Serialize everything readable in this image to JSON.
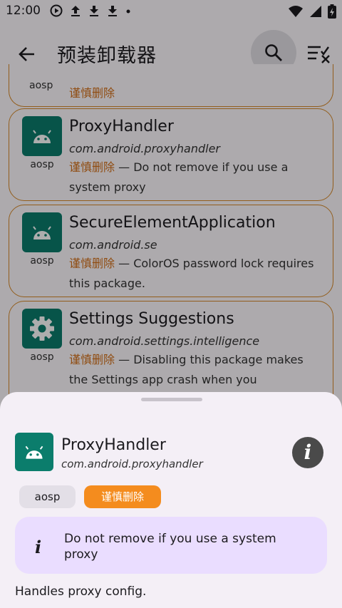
{
  "status_bar": {
    "time": "12:00"
  },
  "app_bar": {
    "title": "预装卸载器"
  },
  "list": {
    "partial_top": {
      "source": "aosp",
      "risk": "谨慎删除"
    },
    "items": [
      {
        "name": "ProxyHandler",
        "package": "com.android.proxyhandler",
        "source": "aosp",
        "risk": "谨慎删除",
        "note": " — Do not remove if you use a system proxy"
      },
      {
        "name": "SecureElementApplication",
        "package": "com.android.se",
        "source": "aosp",
        "risk": "谨慎删除",
        "note": " — ColorOS password lock requires this package."
      },
      {
        "name": "Settings Suggestions",
        "package": "com.android.settings.intelligence",
        "source": "aosp",
        "risk": "谨慎删除",
        "note": " — Disabling this package makes the Settings app crash when you"
      }
    ]
  },
  "sheet": {
    "name": "ProxyHandler",
    "package": "com.android.proxyhandler",
    "info_glyph": "i",
    "chips": {
      "source": "aosp",
      "risk": "谨慎删除"
    },
    "notice_glyph": "i",
    "notice": "Do not remove if you use a system proxy",
    "description": "Handles proxy config."
  },
  "colors": {
    "accent": "#0b7d6c",
    "warning": "#d4711a",
    "chip_warning": "#f48c1e",
    "notice_bg": "#eaddff"
  }
}
